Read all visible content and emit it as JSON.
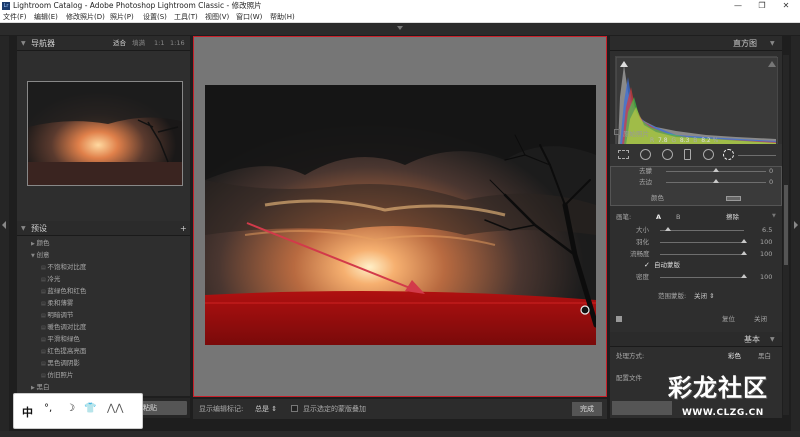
{
  "window": {
    "title": "Lightroom Catalog - Adobe Photoshop Lightroom Classic - 修改照片",
    "app_badge": "Lr",
    "controls": [
      "—",
      "❐",
      "✕"
    ]
  },
  "menu": [
    "文件(F)",
    "编辑(E)",
    "修改照片(D)",
    "照片(P)",
    "设置(S)",
    "工具(T)",
    "视图(V)",
    "窗口(W)",
    "帮助(H)"
  ],
  "navigator": {
    "title": "导航器",
    "zoom": [
      "适合",
      "填满",
      "1:1",
      "1:16"
    ]
  },
  "presets": {
    "title": "预设",
    "add": "+",
    "groups": [
      {
        "label": "颜色",
        "expanded": false
      },
      {
        "label": "创意",
        "expanded": true
      }
    ],
    "items": [
      "不饱和对比度",
      "冷光",
      "蓝绿色和红色",
      "柔和薄雾",
      "明暗调节",
      "暖色调对比度",
      "平滑和绿色",
      "红色提高亮面",
      "黑色调阴影",
      "仿旧照片"
    ],
    "after_group": "黑白"
  },
  "left_bottom": {
    "paste_button": "粘贴"
  },
  "ime_bar": {
    "items": [
      "中",
      "°,",
      "☽",
      "👕",
      "⋀⋀"
    ]
  },
  "toolbar": {
    "label": "显示编辑标记:",
    "value": "总是",
    "overlay_label": "显示选定的蒙版叠加",
    "done_button": "完成"
  },
  "histogram": {
    "title": "直方图",
    "readout": {
      "r_label": "R",
      "r": "7.8",
      "g_label": "G",
      "g": "8.3",
      "b_label": "B",
      "b": "8.2",
      "unit": "%"
    },
    "original_label": "原始照片"
  },
  "mask_panel": {
    "partial_rows": [
      {
        "label": "去朦",
        "value": "0",
        "knob": 0.5
      },
      {
        "label": "去边",
        "value": "0",
        "knob": 0.5
      }
    ],
    "color_label": "颜色",
    "brush_label": "画笔:",
    "brush_a": "A",
    "brush_b": "B",
    "brush_erase": "擦除",
    "size_label": "大小",
    "size_value": "6.5",
    "size_level": 0.1,
    "feather_label": "羽化",
    "feather_value": "100",
    "feather_level": 1.0,
    "flow_label": "流畅度",
    "flow_value": "100",
    "flow_level": 1.0,
    "automask_label": "自动蒙版",
    "density_label": "密度",
    "density_value": "100",
    "density_level": 1.0,
    "range_label": "范围蒙版:",
    "range_value": "关闭",
    "reset_button": "复位",
    "close_button": "关闭"
  },
  "basic": {
    "title": "基本",
    "process_label": "处理方式:",
    "color_option": "彩色",
    "bw_option": "黑白",
    "profile_label": "配置文件"
  },
  "watermark": {
    "text": "彩龙社区",
    "url": "WWW.CLZG.CN"
  },
  "colors": {
    "accent_red": "#c8202a",
    "mask_overlay": "#c81414",
    "panel_bg": "#2e2e2e"
  }
}
